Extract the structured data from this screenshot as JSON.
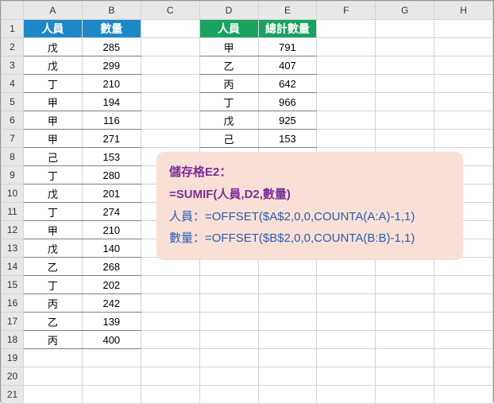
{
  "columns": [
    "A",
    "B",
    "C",
    "D",
    "E",
    "F",
    "G",
    "H"
  ],
  "header1": {
    "A": "人員",
    "B": "數量",
    "D": "人員",
    "E": "總計數量"
  },
  "table1": [
    {
      "p": "戊",
      "q": "285"
    },
    {
      "p": "戊",
      "q": "299"
    },
    {
      "p": "丁",
      "q": "210"
    },
    {
      "p": "甲",
      "q": "194"
    },
    {
      "p": "甲",
      "q": "116"
    },
    {
      "p": "甲",
      "q": "271"
    },
    {
      "p": "己",
      "q": "153"
    },
    {
      "p": "丁",
      "q": "280"
    },
    {
      "p": "戊",
      "q": "201"
    },
    {
      "p": "丁",
      "q": "274"
    },
    {
      "p": "甲",
      "q": "210"
    },
    {
      "p": "戊",
      "q": "140"
    },
    {
      "p": "乙",
      "q": "268"
    },
    {
      "p": "丁",
      "q": "202"
    },
    {
      "p": "丙",
      "q": "242"
    },
    {
      "p": "乙",
      "q": "139"
    },
    {
      "p": "丙",
      "q": "400"
    }
  ],
  "table2": [
    {
      "p": "甲",
      "t": "791"
    },
    {
      "p": "乙",
      "t": "407"
    },
    {
      "p": "丙",
      "t": "642"
    },
    {
      "p": "丁",
      "t": "966"
    },
    {
      "p": "戊",
      "t": "925"
    },
    {
      "p": "己",
      "t": "153"
    }
  ],
  "callout": {
    "line1a": "儲存格E2：",
    "line1b": "=SUMIF(人員,D2,數量)",
    "line2": "人員：=OFFSET($A$2,0,0,COUNTA(A:A)-1,1)",
    "line3": "數量：=OFFSET($B$2,0,0,COUNTA(B:B)-1,1)"
  },
  "rowCount": 21
}
